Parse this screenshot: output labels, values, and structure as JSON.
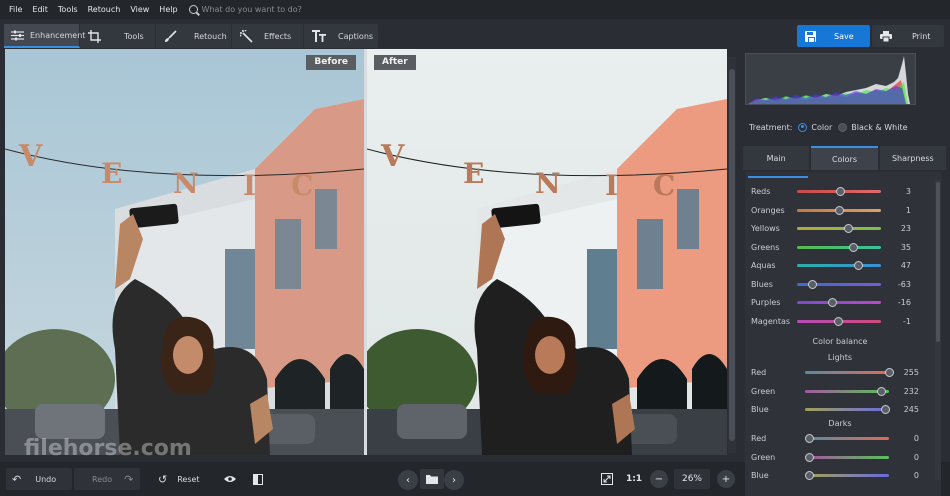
{
  "menu": {
    "items": [
      "File",
      "Edit",
      "Tools",
      "Retouch",
      "View",
      "Help"
    ],
    "search_placeholder": "What do you want to do?"
  },
  "toolbar": {
    "tabs": [
      {
        "label": "Enhancement",
        "icon": "sliders-icon",
        "active": true
      },
      {
        "label": "Tools",
        "icon": "crop-icon",
        "active": false
      },
      {
        "label": "Retouch",
        "icon": "brush-icon",
        "active": false
      },
      {
        "label": "Effects",
        "icon": "magic-wand-icon",
        "active": false
      },
      {
        "label": "Captions",
        "icon": "text-icon",
        "active": false
      }
    ]
  },
  "actions": {
    "save_label": "Save",
    "print_label": "Print"
  },
  "photo": {
    "before_label": "Before",
    "after_label": "After",
    "sign_letters": [
      "V",
      "E",
      "N",
      "I",
      "C"
    ],
    "watermark": "filehorse.com"
  },
  "bottom": {
    "undo_label": "Undo",
    "redo_label": "Redo",
    "reset_label": "Reset",
    "zoom_one_to_one": "1:1",
    "zoom_level": "26%"
  },
  "panel": {
    "treatment_label": "Treatment:",
    "treatment_options": [
      "Color",
      "Black & White"
    ],
    "treatment_selected": "Color",
    "tabs": [
      {
        "label": "Main",
        "active": false
      },
      {
        "label": "Colors",
        "active": true
      },
      {
        "label": "Sharpness",
        "active": false
      }
    ],
    "color_sliders": [
      {
        "label": "Reds",
        "value": "3",
        "gradient": [
          "#c84a4a",
          "#e06a6a"
        ]
      },
      {
        "label": "Oranges",
        "value": "1",
        "gradient": [
          "#c8783a",
          "#e0a060"
        ]
      },
      {
        "label": "Yellows",
        "value": "23",
        "gradient": [
          "#b8a83a",
          "#7cc04a"
        ]
      },
      {
        "label": "Greens",
        "value": "35",
        "gradient": [
          "#5ab84a",
          "#3ac0a0"
        ]
      },
      {
        "label": "Aquas",
        "value": "47",
        "gradient": [
          "#2ab0a8",
          "#3a90d8"
        ]
      },
      {
        "label": "Blues",
        "value": "-63",
        "gradient": [
          "#3a6ad8",
          "#7a5ad8"
        ]
      },
      {
        "label": "Purples",
        "value": "-16",
        "gradient": [
          "#7a4ad0",
          "#b84ac8"
        ]
      },
      {
        "label": "Magentas",
        "value": "-1",
        "gradient": [
          "#b84ab8",
          "#d04a7a"
        ]
      }
    ],
    "color_balance_label": "Color balance",
    "lights_label": "Lights",
    "lights": [
      {
        "label": "Red",
        "value": "255",
        "gradient": [
          "#5a8aa0",
          "#e06a5a"
        ]
      },
      {
        "label": "Green",
        "value": "232",
        "gradient": [
          "#a05aa0",
          "#5ac05a"
        ]
      },
      {
        "label": "Blue",
        "value": "245",
        "gradient": [
          "#a0a05a",
          "#6a6ae0"
        ]
      }
    ],
    "darks_label": "Darks",
    "darks": [
      {
        "label": "Red",
        "value": "0",
        "gradient": [
          "#5a8aa0",
          "#e06a5a"
        ]
      },
      {
        "label": "Green",
        "value": "0",
        "gradient": [
          "#a05aa0",
          "#5ac05a"
        ]
      },
      {
        "label": "Blue",
        "value": "0",
        "gradient": [
          "#a0a05a",
          "#6a6ae0"
        ]
      }
    ]
  },
  "colors": {
    "accent": "#1677d6",
    "tab_highlight": "#3a8ee6"
  }
}
